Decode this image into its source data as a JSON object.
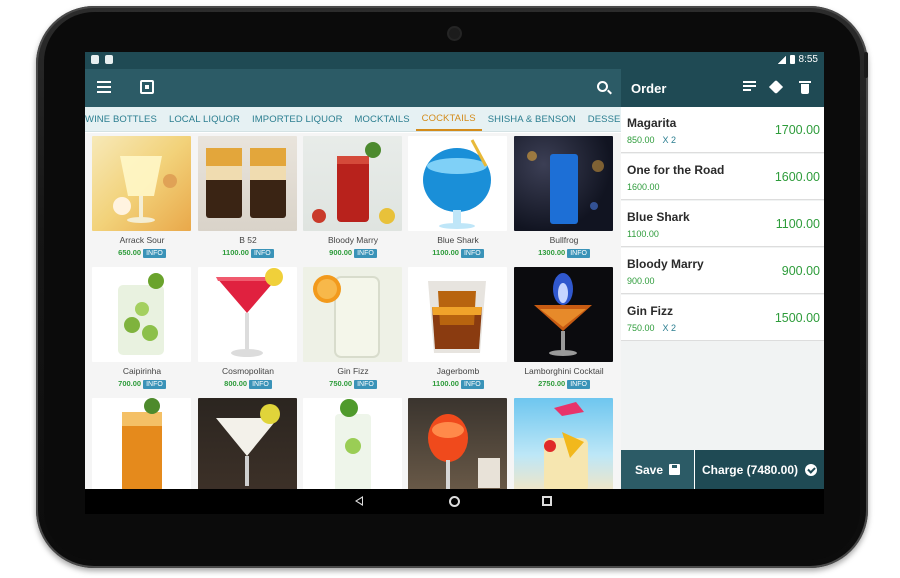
{
  "status_bar": {
    "time": "8:55"
  },
  "toolbar": {
    "menu_icon": "menu-icon",
    "screen_icon": "save-screen-icon",
    "search_icon": "search-icon"
  },
  "order_header": {
    "title": "Order",
    "icons": [
      "sort-icon",
      "tag-icon",
      "trash-icon"
    ]
  },
  "tabs": [
    {
      "label": "WINE BOTTLES",
      "active": false
    },
    {
      "label": "LOCAL LIQUOR",
      "active": false
    },
    {
      "label": "IMPORTED LIQUOR",
      "active": false
    },
    {
      "label": "MOCKTAILS",
      "active": false
    },
    {
      "label": "COCKTAILS",
      "active": true
    },
    {
      "label": "SHISHA & BENSON",
      "active": false
    },
    {
      "label": "DESSERTS",
      "active": false
    }
  ],
  "info_label": "INFO",
  "products": [
    {
      "name": "Arrack Sour",
      "price": "650.00"
    },
    {
      "name": "B 52",
      "price": "1100.00"
    },
    {
      "name": "Bloody Marry",
      "price": "900.00"
    },
    {
      "name": "Blue Shark",
      "price": "1100.00"
    },
    {
      "name": "Bullfrog",
      "price": "1300.00"
    },
    {
      "name": "Caipirinha",
      "price": "700.00"
    },
    {
      "name": "Cosmopolitan",
      "price": "800.00"
    },
    {
      "name": "Gin Fizz",
      "price": "750.00"
    },
    {
      "name": "Jagerbomb",
      "price": "1100.00"
    },
    {
      "name": "Lamborghini Cocktail",
      "price": "2750.00"
    },
    {
      "name": "",
      "price": ""
    },
    {
      "name": "",
      "price": ""
    },
    {
      "name": "",
      "price": ""
    },
    {
      "name": "",
      "price": ""
    },
    {
      "name": "",
      "price": ""
    }
  ],
  "order_items": [
    {
      "name": "Magarita",
      "unit_price": "850.00",
      "qty": "X 2",
      "total": "1700.00"
    },
    {
      "name": "One for the Road",
      "unit_price": "1600.00",
      "qty": "",
      "total": "1600.00"
    },
    {
      "name": "Blue Shark",
      "unit_price": "1100.00",
      "qty": "",
      "total": "1100.00"
    },
    {
      "name": "Bloody Marry",
      "unit_price": "900.00",
      "qty": "",
      "total": "900.00"
    },
    {
      "name": "Gin Fizz",
      "unit_price": "750.00",
      "qty": "X 2",
      "total": "1500.00"
    }
  ],
  "actions": {
    "save_label": "Save",
    "charge_label": "Charge (7480.00)"
  },
  "colors": {
    "primary": "#2c5b66",
    "dark": "#1f4a54",
    "accent_tab": "#d38b1a",
    "price_green": "#2e9c3b",
    "tab_text": "#2b7e90"
  }
}
